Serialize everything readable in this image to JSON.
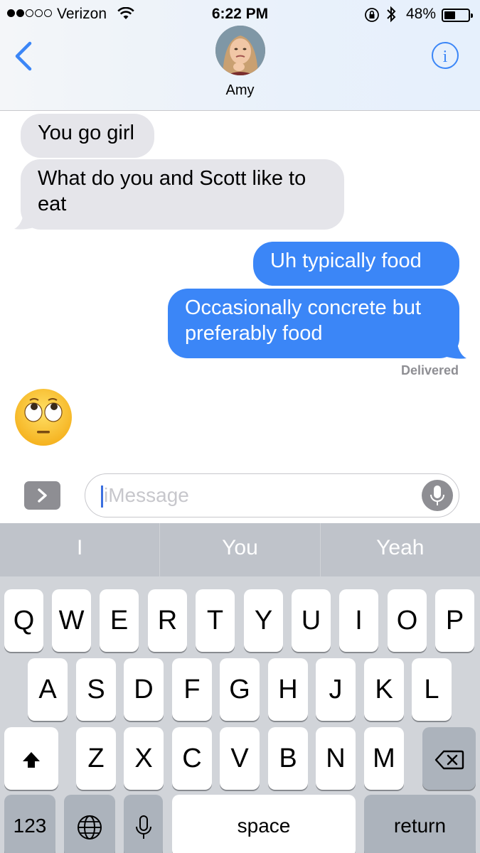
{
  "status_bar": {
    "carrier": "Verizon",
    "signal_bars_filled": 2,
    "signal_bars_total": 5,
    "time": "6:22 PM",
    "battery": "48%",
    "battery_level": 0.48
  },
  "header": {
    "contact_name": "Amy",
    "back_icon": "chevron-left-icon",
    "info_icon": "info-icon"
  },
  "messages": [
    {
      "direction": "in",
      "text": "You go girl"
    },
    {
      "direction": "in",
      "text": "What do you and Scott like to\neat"
    },
    {
      "direction": "out",
      "text": "Uh typically food"
    },
    {
      "direction": "out",
      "text": "Occasionally concrete but\npreferably food"
    }
  ],
  "delivered_label": "Delivered",
  "emoji_message": "face-with-rolling-eyes",
  "input": {
    "placeholder": "iMessage"
  },
  "predictions": [
    "I",
    "You",
    "Yeah"
  ],
  "keyboard": {
    "row1": [
      "Q",
      "W",
      "E",
      "R",
      "T",
      "Y",
      "U",
      "I",
      "O",
      "P"
    ],
    "row2": [
      "A",
      "S",
      "D",
      "F",
      "G",
      "H",
      "J",
      "K",
      "L"
    ],
    "row3": [
      "Z",
      "X",
      "C",
      "V",
      "B",
      "N",
      "M"
    ],
    "numbers_label": "123",
    "space_label": "space",
    "return_label": "return"
  },
  "colors": {
    "outgoing_bubble": "#3b86f7",
    "incoming_bubble": "#e5e5ea",
    "accent": "#3b86f7"
  }
}
